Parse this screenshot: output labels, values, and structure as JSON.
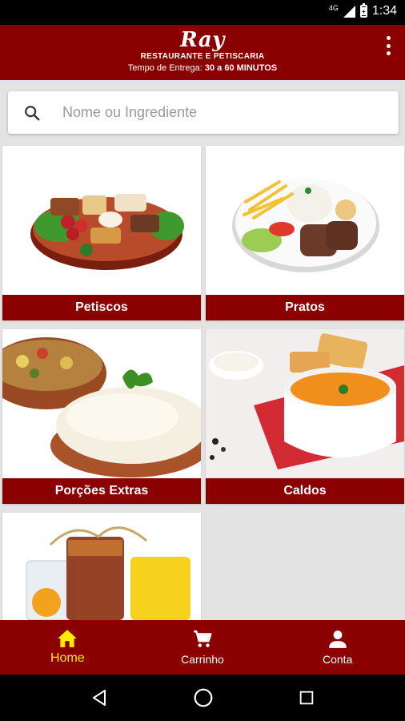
{
  "status_bar": {
    "network": "4G",
    "battery_glyph": "+",
    "time": "1:34"
  },
  "app_bar": {
    "brand": "Ray",
    "subtitle": "RESTAURANTE E PETISCARIA",
    "delivery_label": "Tempo de Entrega:",
    "delivery_time": "30 a 60 MINUTOS",
    "menu_icon": "more-vert-icon"
  },
  "search": {
    "placeholder": "Nome ou Ingrediente",
    "value": "",
    "icon": "search-icon"
  },
  "categories": [
    {
      "label": "Petiscos"
    },
    {
      "label": "Pratos"
    },
    {
      "label": "Porções Extras"
    },
    {
      "label": "Caldos"
    },
    {
      "label": ""
    }
  ],
  "bottom_nav": [
    {
      "label": "Home",
      "icon": "home-icon",
      "active": true
    },
    {
      "label": "Carrinho",
      "icon": "cart-icon",
      "active": false
    },
    {
      "label": "Conta",
      "icon": "person-icon",
      "active": false
    }
  ],
  "colors": {
    "primary": "#8b0000",
    "active_nav": "#ffeb00",
    "background": "#e3e3e3"
  }
}
